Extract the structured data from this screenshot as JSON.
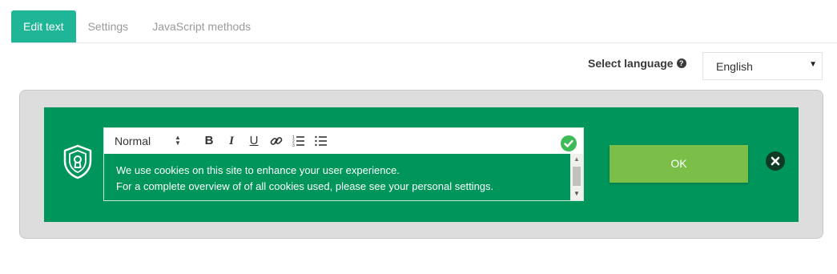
{
  "tabs": [
    {
      "label": "Edit text",
      "active": true
    },
    {
      "label": "Settings",
      "active": false
    },
    {
      "label": "JavaScript methods",
      "active": false
    }
  ],
  "language": {
    "label": "Select language",
    "help_icon": "question-circle-icon",
    "selected": "English"
  },
  "editor": {
    "format": "Normal",
    "toolbar_icons": [
      "bold-icon",
      "italic-icon",
      "underline-icon",
      "link-icon",
      "ordered-list-icon",
      "bullet-list-icon"
    ],
    "lines": [
      "We use cookies on this site to enhance your user experience.",
      "For a complete overview of of all cookies used, please see your  personal settings."
    ]
  },
  "banner": {
    "ok_label": "OK",
    "icon": "shield-keyhole-icon",
    "colors": {
      "banner": "#00955a",
      "ok": "#7bbe48",
      "tab_active": "#1fb698"
    }
  }
}
